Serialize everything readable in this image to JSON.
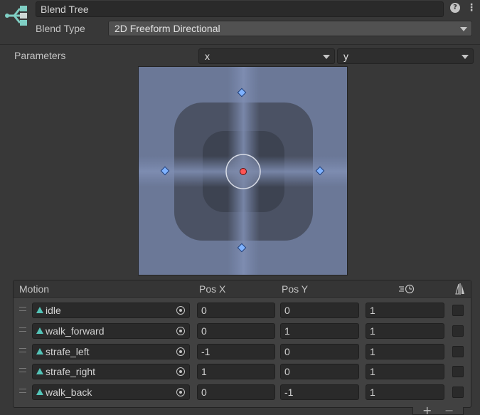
{
  "header": {
    "name_value": "Blend Tree",
    "blend_type_label": "Blend Type",
    "blend_type_value": "2D Freeform Directional"
  },
  "parameters": {
    "label": "Parameters",
    "param_x": "x",
    "param_y": "y"
  },
  "list": {
    "col_motion": "Motion",
    "col_posx": "Pos X",
    "col_posy": "Pos Y",
    "rows": [
      {
        "motion": "idle",
        "pos_x": "0",
        "pos_y": "0",
        "speed": "1"
      },
      {
        "motion": "walk_forward",
        "pos_x": "0",
        "pos_y": "1",
        "speed": "1"
      },
      {
        "motion": "strafe_left",
        "pos_x": "-1",
        "pos_y": "0",
        "speed": "1"
      },
      {
        "motion": "strafe_right",
        "pos_x": "1",
        "pos_y": "0",
        "speed": "1"
      },
      {
        "motion": "walk_back",
        "pos_x": "0",
        "pos_y": "-1",
        "speed": "1"
      }
    ]
  },
  "footer": {
    "add_symbol": "+",
    "remove_symbol": "−"
  },
  "icons": {
    "tree": "blend-tree-icon",
    "help": "help-icon",
    "menu": "kebab-menu-icon",
    "speed": "time-scale-icon",
    "mirror": "mirror-icon",
    "clip": "animation-clip-icon",
    "picker": "object-picker-icon"
  },
  "colors": {
    "background": "#383838",
    "graph_dark": "#3f4452",
    "graph_light": "#7a8ab0",
    "motion_point": "#7fb2ff",
    "current_point": "#ff5555"
  }
}
